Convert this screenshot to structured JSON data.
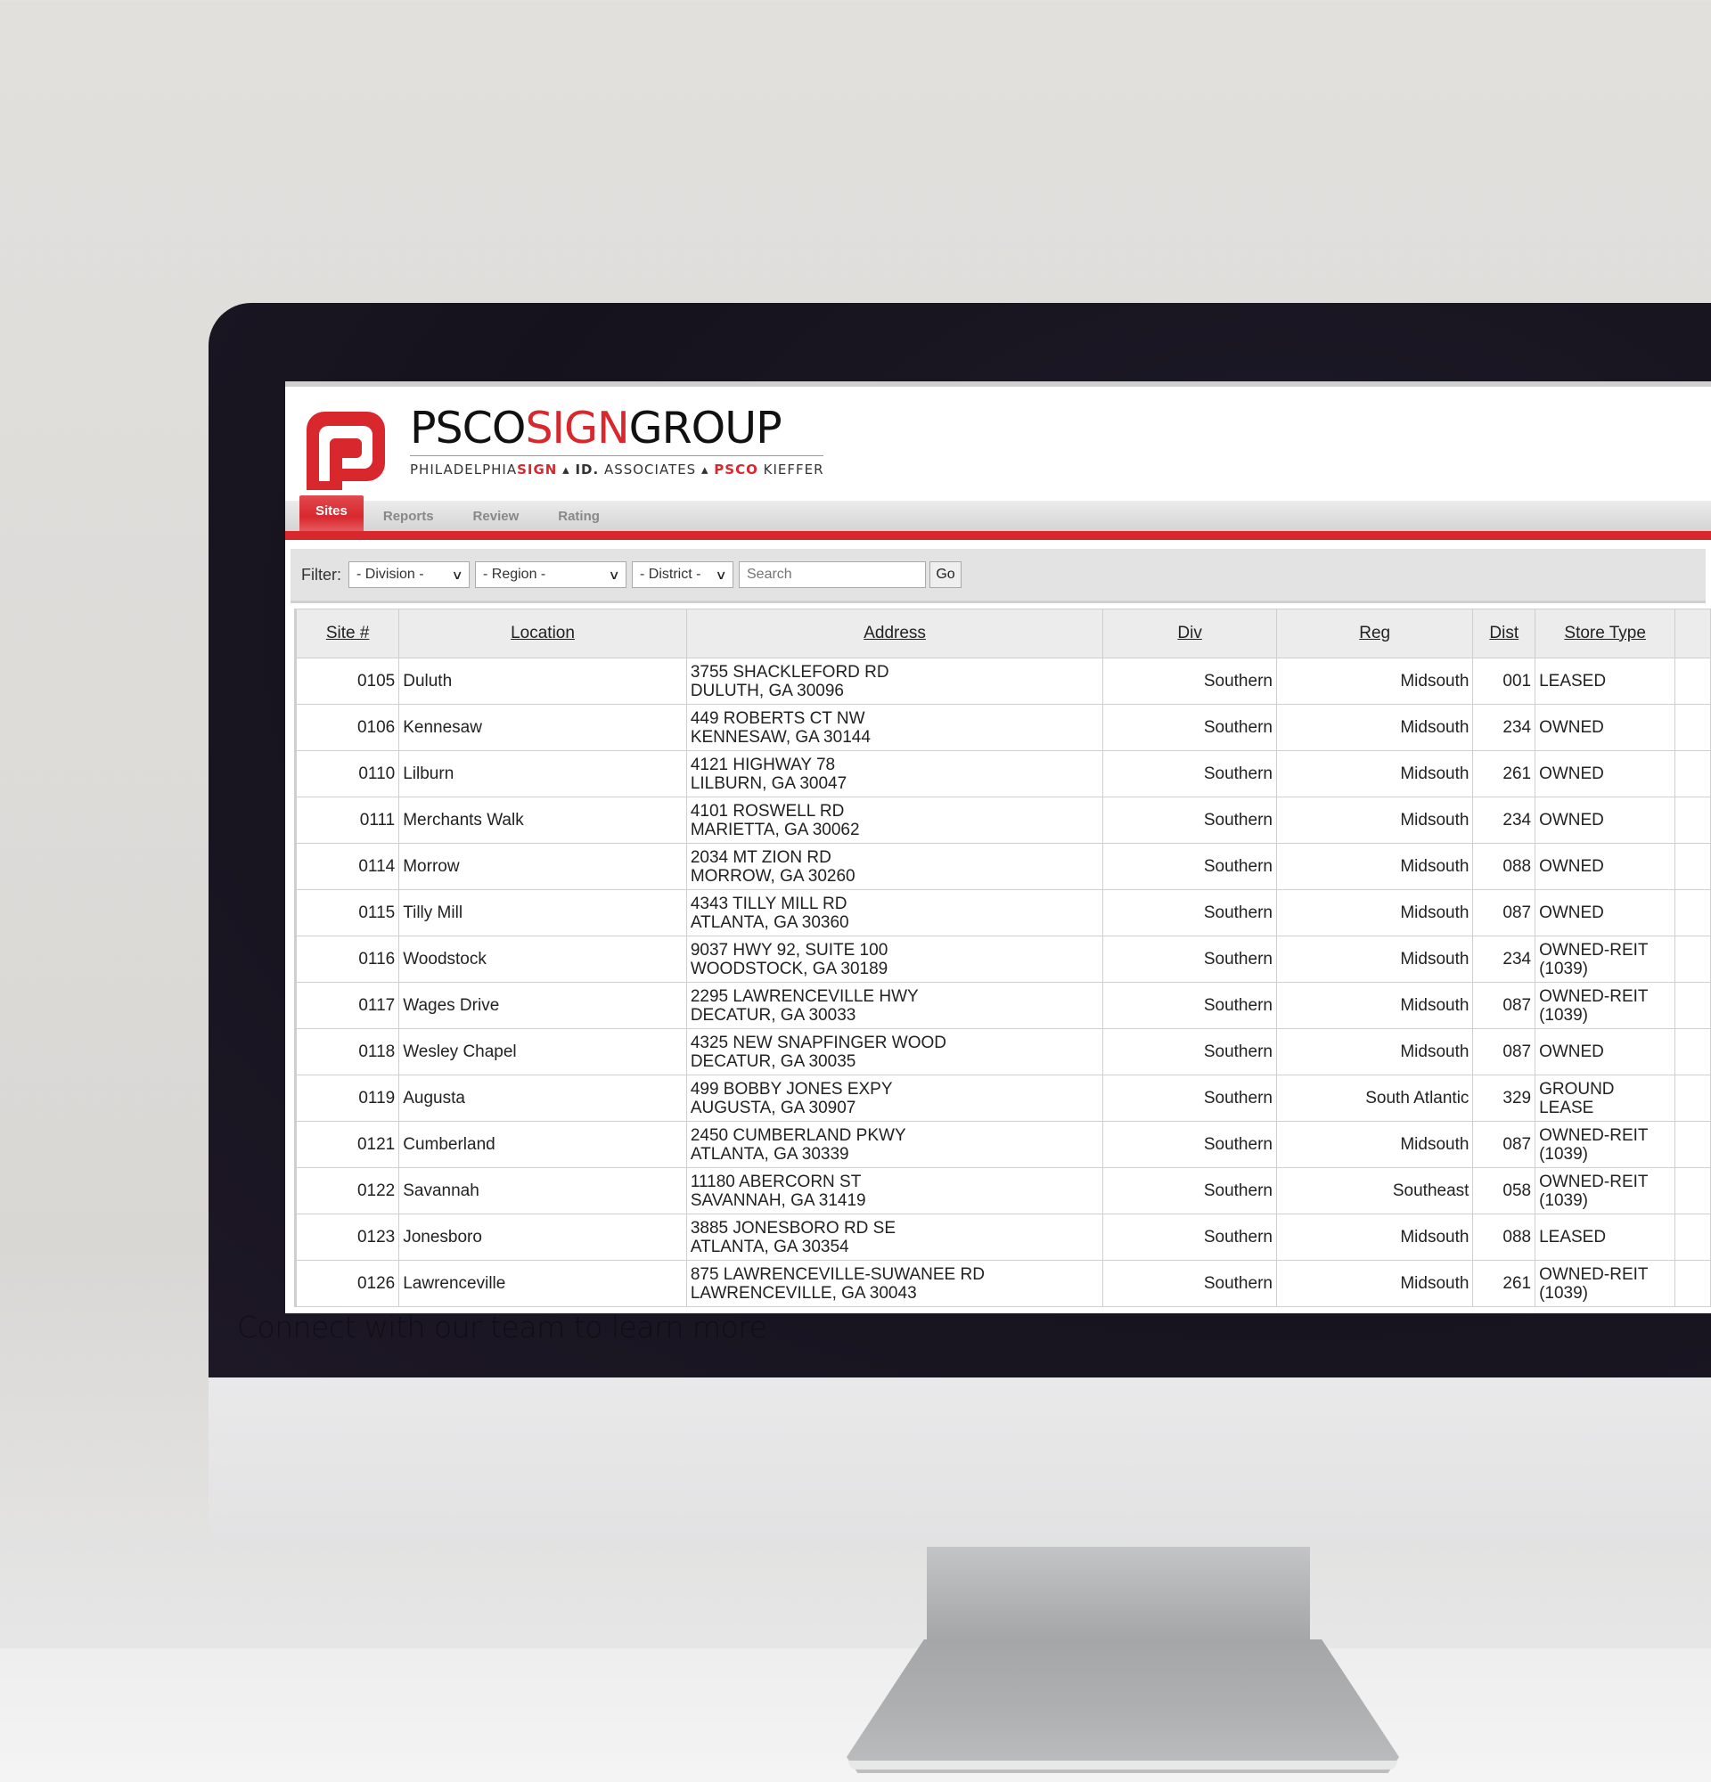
{
  "brand": {
    "title_part1": "PSCO",
    "title_part2": "SIGN",
    "title_part3": "GROUP",
    "sub_part1": "PHILADELPHIA",
    "sub_part2": "SIGN",
    "sub_sep1": " ▴ ",
    "sub_part3": "ID.",
    "sub_part4": " ASSOCIATES",
    "sub_sep2": " ▴ ",
    "sub_part5": "PSCO",
    "sub_part6": " KIEFFER",
    "accent_color": "#d9272e"
  },
  "nav": {
    "tabs": [
      {
        "label": "Sites",
        "active": true
      },
      {
        "label": "Reports",
        "active": false
      },
      {
        "label": "Review",
        "active": false
      },
      {
        "label": "Rating",
        "active": false
      }
    ]
  },
  "filter": {
    "label": "Filter:",
    "division": "- Division -",
    "region": "- Region -",
    "district": "- District -",
    "search_placeholder": "Search",
    "search_value": "",
    "go_label": "Go",
    "chevron": "∨"
  },
  "table": {
    "headers": [
      "Site #",
      "Location",
      "Address",
      "Div",
      "Reg",
      "Dist",
      "Store Type"
    ],
    "rows": [
      {
        "site": "0105",
        "location": "Duluth",
        "addr1": "3755 SHACKLEFORD RD",
        "addr2": "DULUTH, GA 30096",
        "div": "Southern",
        "reg": "Midsouth",
        "dist": "001",
        "type1": "LEASED",
        "type2": ""
      },
      {
        "site": "0106",
        "location": "Kennesaw",
        "addr1": "449 ROBERTS CT NW",
        "addr2": "KENNESAW, GA 30144",
        "div": "Southern",
        "reg": "Midsouth",
        "dist": "234",
        "type1": "OWNED",
        "type2": ""
      },
      {
        "site": "0110",
        "location": "Lilburn",
        "addr1": "4121 HIGHWAY 78",
        "addr2": "LILBURN, GA 30047",
        "div": "Southern",
        "reg": "Midsouth",
        "dist": "261",
        "type1": "OWNED",
        "type2": ""
      },
      {
        "site": "0111",
        "location": "Merchants Walk",
        "addr1": "4101 ROSWELL RD",
        "addr2": "MARIETTA, GA 30062",
        "div": "Southern",
        "reg": "Midsouth",
        "dist": "234",
        "type1": "OWNED",
        "type2": ""
      },
      {
        "site": "0114",
        "location": "Morrow",
        "addr1": "2034 MT ZION RD",
        "addr2": "MORROW, GA 30260",
        "div": "Southern",
        "reg": "Midsouth",
        "dist": "088",
        "type1": "OWNED",
        "type2": ""
      },
      {
        "site": "0115",
        "location": "Tilly Mill",
        "addr1": "4343 TILLY MILL RD",
        "addr2": "ATLANTA, GA 30360",
        "div": "Southern",
        "reg": "Midsouth",
        "dist": "087",
        "type1": "OWNED",
        "type2": ""
      },
      {
        "site": "0116",
        "location": "Woodstock",
        "addr1": "9037 HWY 92, SUITE 100",
        "addr2": "WOODSTOCK, GA 30189",
        "div": "Southern",
        "reg": "Midsouth",
        "dist": "234",
        "type1": "OWNED-REIT",
        "type2": "(1039)"
      },
      {
        "site": "0117",
        "location": "Wages Drive",
        "addr1": "2295 LAWRENCEVILLE HWY",
        "addr2": "DECATUR, GA 30033",
        "div": "Southern",
        "reg": "Midsouth",
        "dist": "087",
        "type1": "OWNED-REIT",
        "type2": "(1039)"
      },
      {
        "site": "0118",
        "location": "Wesley Chapel",
        "addr1": "4325 NEW SNAPFINGER WOOD",
        "addr2": "DECATUR, GA 30035",
        "div": "Southern",
        "reg": "Midsouth",
        "dist": "087",
        "type1": "OWNED",
        "type2": ""
      },
      {
        "site": "0119",
        "location": "Augusta",
        "addr1": "499 BOBBY JONES EXPY",
        "addr2": "AUGUSTA, GA 30907",
        "div": "Southern",
        "reg": "South Atlantic",
        "dist": "329",
        "type1": "GROUND",
        "type2": "LEASE"
      },
      {
        "site": "0121",
        "location": "Cumberland",
        "addr1": "2450 CUMBERLAND PKWY",
        "addr2": "ATLANTA, GA 30339",
        "div": "Southern",
        "reg": "Midsouth",
        "dist": "087",
        "type1": "OWNED-REIT",
        "type2": "(1039)"
      },
      {
        "site": "0122",
        "location": "Savannah",
        "addr1": "11180 ABERCORN ST",
        "addr2": "SAVANNAH, GA 31419",
        "div": "Southern",
        "reg": "Southeast",
        "dist": "058",
        "type1": "OWNED-REIT",
        "type2": "(1039)"
      },
      {
        "site": "0123",
        "location": "Jonesboro",
        "addr1": "3885 JONESBORO RD SE",
        "addr2": "ATLANTA, GA 30354",
        "div": "Southern",
        "reg": "Midsouth",
        "dist": "088",
        "type1": "LEASED",
        "type2": ""
      },
      {
        "site": "0126",
        "location": "Lawrenceville",
        "addr1": "875 LAWRENCEVILLE-SUWANEE RD",
        "addr2": "LAWRENCEVILLE, GA 30043",
        "div": "Southern",
        "reg": "Midsouth",
        "dist": "261",
        "type1": "OWNED-REIT",
        "type2": "(1039)"
      }
    ]
  },
  "overlay": {
    "text": "Connect with our team to learn more"
  }
}
